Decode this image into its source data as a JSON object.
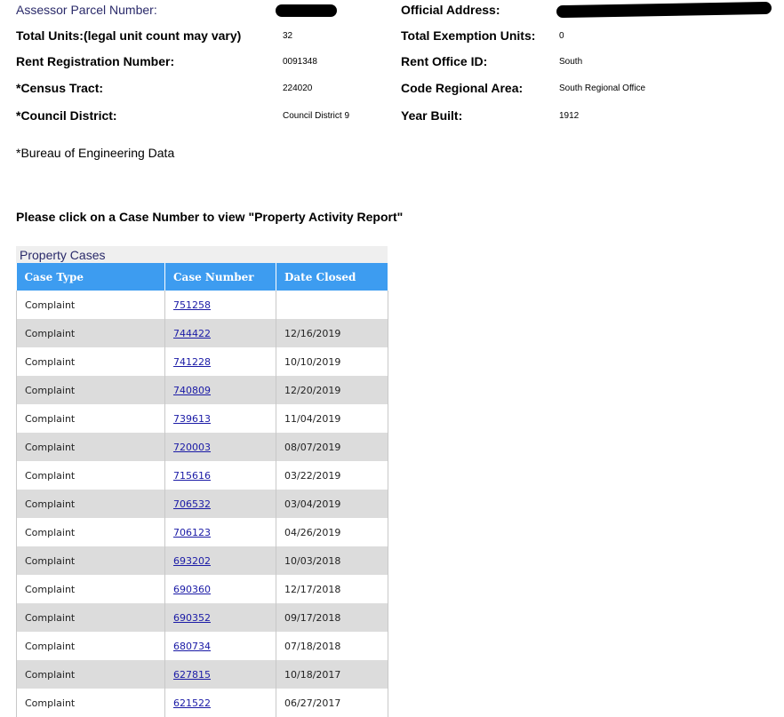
{
  "property_info": {
    "assessor_parcel_label": "Assessor Parcel Number:",
    "official_address_label": "Official Address:",
    "total_units_label": "Total Units:(legal unit count may vary)",
    "total_units_value": "32",
    "total_exemption_label": "Total Exemption Units:",
    "total_exemption_value": "0",
    "rent_registration_label": "Rent Registration Number:",
    "rent_registration_value": "0091348",
    "rent_office_label": "Rent Office ID:",
    "rent_office_value": "South",
    "census_tract_label": "*Census Tract:",
    "census_tract_value": "224020",
    "code_regional_label": "Code Regional Area:",
    "code_regional_value": "South Regional Office",
    "council_district_label": "*Council District:",
    "council_district_value": "Council District 9",
    "year_built_label": "Year Built:",
    "year_built_value": "1912"
  },
  "footnote": "*Bureau of Engineering Data",
  "instructions": "Please click on a Case Number to view \"Property Activity Report\"",
  "cases_table": {
    "caption": "Property Cases",
    "headers": [
      "Case Type",
      "Case Number",
      "Date Closed"
    ],
    "rows": [
      {
        "type": "Complaint",
        "number": "751258",
        "date": ""
      },
      {
        "type": "Complaint",
        "number": "744422",
        "date": "12/16/2019"
      },
      {
        "type": "Complaint",
        "number": "741228",
        "date": "10/10/2019"
      },
      {
        "type": "Complaint",
        "number": "740809",
        "date": "12/20/2019"
      },
      {
        "type": "Complaint",
        "number": "739613",
        "date": "11/04/2019"
      },
      {
        "type": "Complaint",
        "number": "720003",
        "date": "08/07/2019"
      },
      {
        "type": "Complaint",
        "number": "715616",
        "date": "03/22/2019"
      },
      {
        "type": "Complaint",
        "number": "706532",
        "date": "03/04/2019"
      },
      {
        "type": "Complaint",
        "number": "706123",
        "date": "04/26/2019"
      },
      {
        "type": "Complaint",
        "number": "693202",
        "date": "10/03/2018"
      },
      {
        "type": "Complaint",
        "number": "690360",
        "date": "12/17/2018"
      },
      {
        "type": "Complaint",
        "number": "690352",
        "date": "09/17/2018"
      },
      {
        "type": "Complaint",
        "number": "680734",
        "date": "07/18/2018"
      },
      {
        "type": "Complaint",
        "number": "627815",
        "date": "10/18/2017"
      },
      {
        "type": "Complaint",
        "number": "621522",
        "date": "06/27/2017"
      }
    ]
  },
  "colors": {
    "header_bg": "#3d9cf0",
    "stripe_bg": "#dcdcdc",
    "link": "#1a1aa6"
  }
}
